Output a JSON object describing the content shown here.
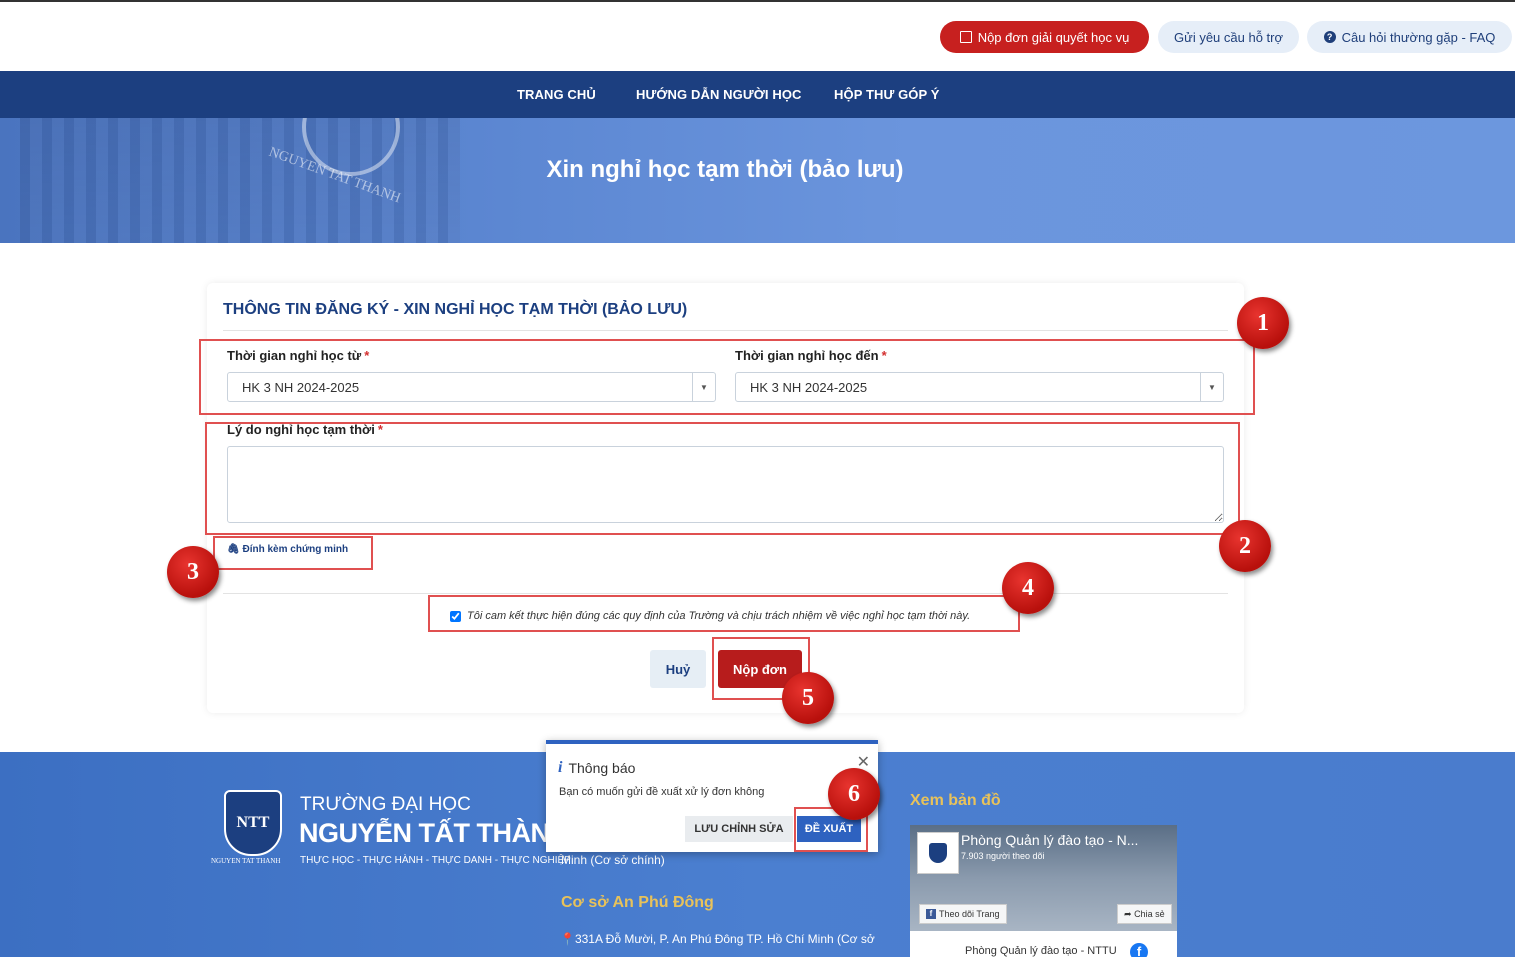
{
  "header": {
    "btn_submit_request": "Nộp đơn giải quyết học vụ",
    "btn_support": "Gửi yêu cầu hỗ trợ",
    "btn_faq": "Câu hỏi thường gặp - FAQ"
  },
  "nav": {
    "home": "TRANG CHỦ",
    "guide": "HƯỚNG DẪN NGƯỜI HỌC",
    "feedback": "HỘP THƯ GÓP Ý"
  },
  "banner": {
    "title": "Xin nghỉ học tạm thời (bảo lưu)",
    "watermark": "NGUYEN TAT THANH"
  },
  "form": {
    "title": "THÔNG TIN ĐĂNG KÝ - XIN NGHỈ HỌC TẠM THỜI (BẢO LƯU)",
    "from_label": "Thời gian nghỉ học từ",
    "from_value": "HK 3 NH 2024-2025",
    "to_label": "Thời gian nghỉ học đến",
    "to_value": "HK 3 NH 2024-2025",
    "reason_label": "Lý do nghỉ học tạm thời",
    "reason_value": "",
    "required_mark": "*",
    "attach_label": "Đính kèm chứng minh",
    "commit_text": "Tôi cam kết thực hiện đúng các quy định của Trường và chịu trách nhiệm về việc nghỉ học tạm thời này.",
    "commit_checked": true,
    "cancel_label": "Huỷ",
    "submit_label": "Nộp đơn"
  },
  "markers": [
    "1",
    "2",
    "3",
    "4",
    "5",
    "6"
  ],
  "dialog": {
    "title": "Thông báo",
    "message": "Bạn có muốn gửi đề xuất xử lý đơn không",
    "save_label": "LƯU CHỈNH SỬA",
    "propose_label": "ĐỀ XUẤT"
  },
  "footer": {
    "logo_text": "NTT",
    "logo_sub": "NGUYEN TAT THANH",
    "uni_line1": "TRƯỜNG ĐẠI HỌC",
    "uni_line2": "NGUYỄN TẤT THÀNH",
    "slogan": "THỰC HỌC - THỰC HÀNH - THỰC DANH - THỰC NGHIỆP",
    "main_campus_tail": "Minh (Cơ sở chính)",
    "campus_name": "Cơ sở An Phú Đông",
    "campus_address": "331A Đỗ Mười, P. An Phú Đông TP. Hồ Chí Minh (Cơ sở",
    "map_title": "Xem bản đồ",
    "fb_page_name": "Phòng Quản lý đào tạo - N...",
    "fb_followers": "7.903 người theo dõi",
    "fb_follow": "Theo dõi Trang",
    "fb_share": "Chia sẻ",
    "fb_post_name": "Phòng Quản lý đào tạo - NTTU"
  },
  "colors": {
    "brand_blue": "#1c3f80",
    "accent_red": "#c7201f",
    "annotation_red": "#e05050",
    "campus_gold": "#e8c25a"
  }
}
